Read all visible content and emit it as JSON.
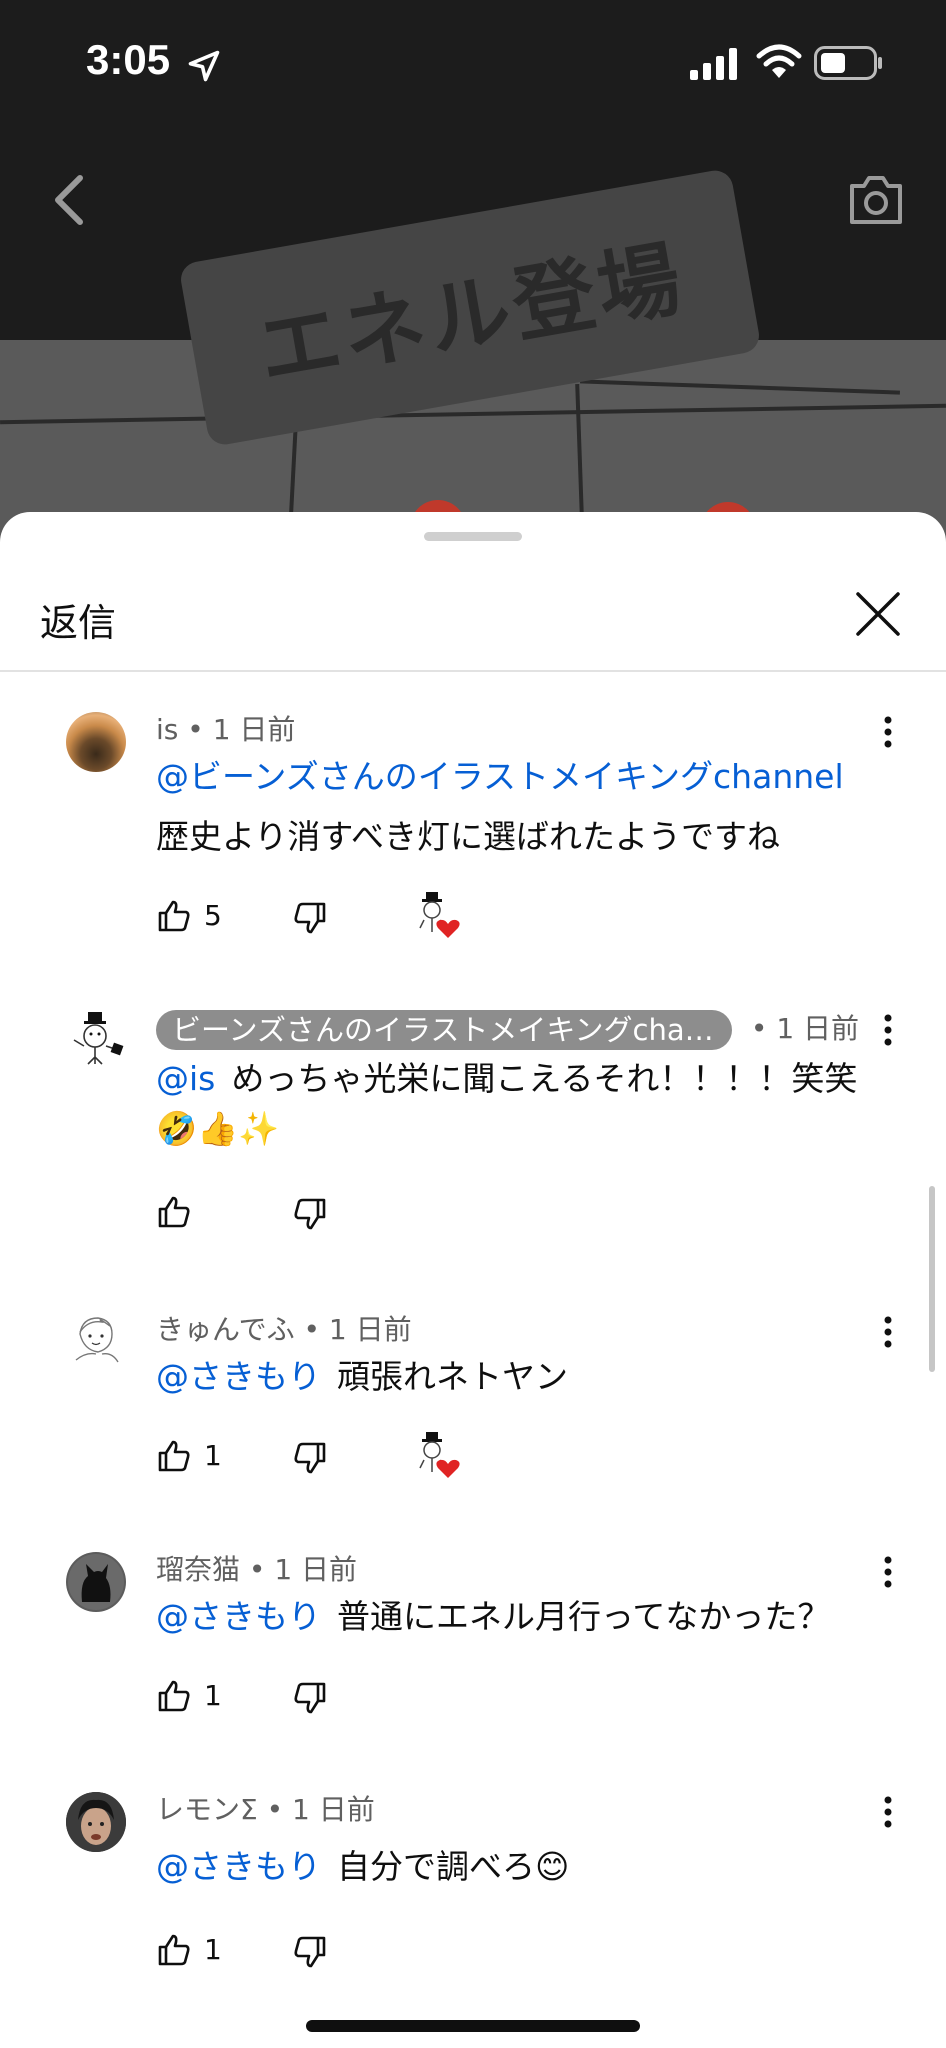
{
  "status_bar": {
    "time": "3:05"
  },
  "video": {
    "banner_text": "エネル登場"
  },
  "sheet": {
    "title": "返信"
  },
  "comments": [
    {
      "author": "is",
      "time": "• 1 日前",
      "mention": "@ビーンズさんのイラストメイキングchannel",
      "text": "歴史より消すべき灯に選ばれたようですね",
      "likes": "5",
      "creator_hearted": true
    },
    {
      "author": "ビーンズさんのイラストメイキングchan…",
      "time": "• 1 日前",
      "mention": "@is",
      "text": "めっちゃ光栄に聞こえるそれ！！！！笑笑",
      "emoji_line": "🤣👍✨",
      "likes": "",
      "creator_hearted": false
    },
    {
      "author": "きゅんでふ",
      "time": "• 1 日前",
      "mention": "@さきもり",
      "text": "頑張れネトヤン",
      "likes": "1",
      "creator_hearted": true
    },
    {
      "author": "瑠奈猫",
      "time": "• 1 日前",
      "mention": "@さきもり",
      "text": "普通にエネル月行ってなかった？",
      "likes": "1",
      "creator_hearted": false
    },
    {
      "author": "レモンΣ",
      "time": "• 1 日前",
      "mention": "@さきもり",
      "text": "自分で調べろ😊",
      "likes": "1",
      "creator_hearted": false
    }
  ]
}
